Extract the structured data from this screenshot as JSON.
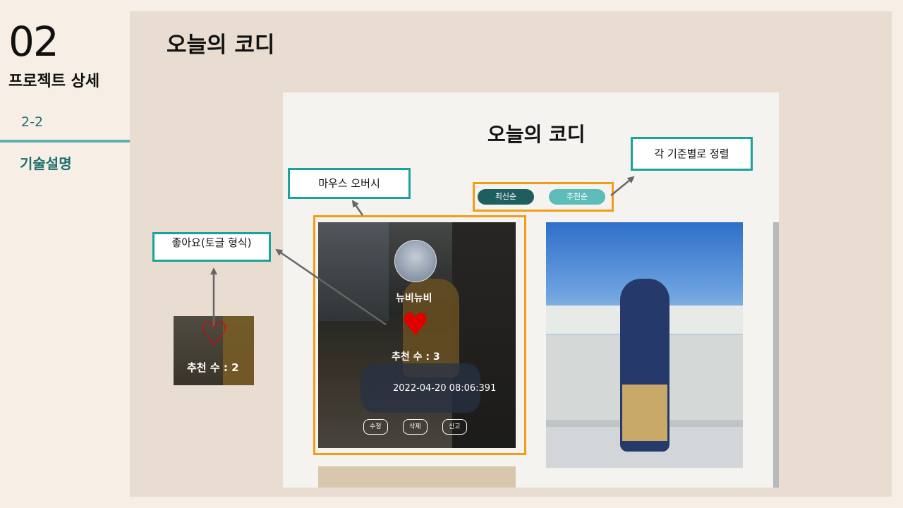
{
  "left_rail": {
    "section_number": "02",
    "section_title": "프로젝트 상세",
    "sub_number": "2-2",
    "sub_title": "기술설명"
  },
  "slide": {
    "heading": "오늘의 코디"
  },
  "screenshot": {
    "title": "오늘의 코디",
    "sort_buttons": {
      "latest": "최신순",
      "recommended": "추천순"
    },
    "card": {
      "user_name": "뉴비뉴비",
      "recommend_count": "추천 수 : 3",
      "date": "2022-04-20 08:06:391",
      "buttons": {
        "edit": "수정",
        "delete": "삭제",
        "report": "신고"
      }
    }
  },
  "callouts": {
    "mouse_hover": "마우스 오버시",
    "sort_by_criteria": "각 기준별로 정렬",
    "like_toggle": "좋아요(토글 형식)"
  },
  "like_example": {
    "recommend_count": "추천 수 : 2"
  },
  "colors": {
    "accent_teal": "#1aa39b",
    "highlight_orange": "#f29c17",
    "heart_red": "#e00000",
    "sort_latest": "#1f5e5e",
    "sort_recommended": "#5bbcb8"
  },
  "icons": {
    "filled_heart": "heart-icon",
    "outline_heart": "heart-outline-icon"
  }
}
